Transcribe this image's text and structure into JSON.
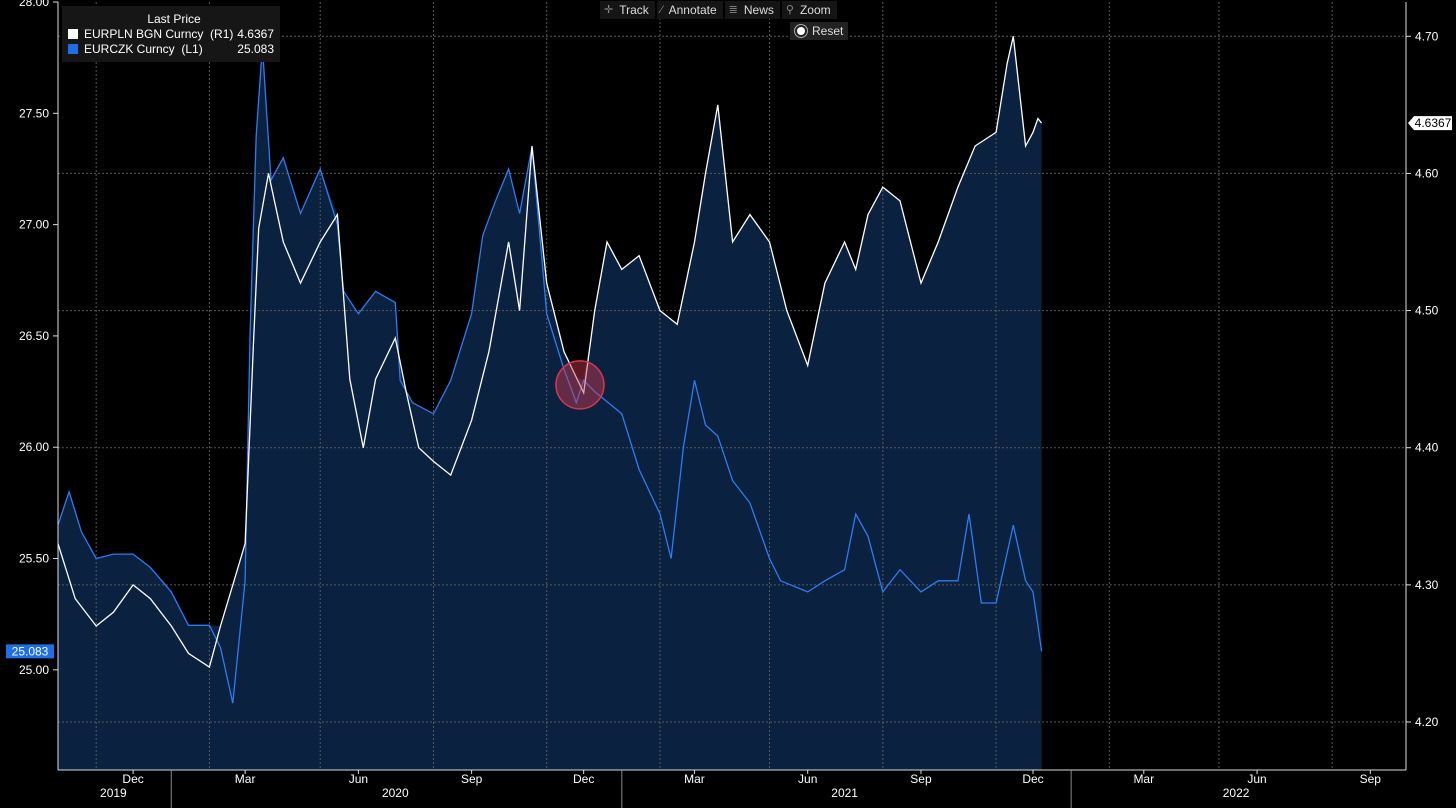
{
  "toolbar": {
    "track": "Track",
    "annotate": "Annotate",
    "news": "News",
    "zoom": "Zoom",
    "reset": "Reset"
  },
  "legend": {
    "header": "Last Price",
    "items": [
      {
        "name": "EURPLN BGN Curncy  (R1)",
        "value": "4.6367",
        "color": "#ffffff"
      },
      {
        "name": "EURCZK Curncy  (L1)",
        "value": "25.083",
        "color": "#1e6fe6"
      }
    ]
  },
  "colors": {
    "background": "#000000",
    "area_fill": "#0a2240",
    "czk_line": "#2e7bf0",
    "pln_line": "#ffffff",
    "highlight": "#d3384f"
  },
  "chart_data": {
    "type": "line",
    "x_ticks": [
      "Dec",
      "Mar",
      "Jun",
      "Sep",
      "Dec",
      "Mar",
      "Jun",
      "Sep",
      "Dec",
      "Mar",
      "Jun",
      "Sep"
    ],
    "years": [
      "2019",
      "2020",
      "2021",
      "2022"
    ],
    "xlim": [
      "2019-10-01",
      "2022-09-30"
    ],
    "y_left": {
      "ticks": [
        "25.00",
        "25.50",
        "26.00",
        "26.50",
        "27.00",
        "27.50",
        "28.00"
      ],
      "lim": [
        24.55,
        28.0
      ]
    },
    "y_right": {
      "ticks": [
        "4.20",
        "4.30",
        "4.40",
        "4.50",
        "4.60",
        "4.70"
      ],
      "lim": [
        4.165,
        4.725
      ]
    },
    "last_value_labels": {
      "left": "25.083",
      "right": "4.6367"
    },
    "grid": true,
    "series": [
      {
        "name": "EURCZK Curncy  (L1)",
        "axis": "left",
        "points": [
          [
            "2019-10-01",
            25.65
          ],
          [
            "2019-10-10",
            25.8
          ],
          [
            "2019-10-20",
            25.62
          ],
          [
            "2019-11-01",
            25.5
          ],
          [
            "2019-11-15",
            25.52
          ],
          [
            "2019-12-01",
            25.52
          ],
          [
            "2019-12-15",
            25.46
          ],
          [
            "2020-01-01",
            25.35
          ],
          [
            "2020-01-15",
            25.2
          ],
          [
            "2020-02-01",
            25.2
          ],
          [
            "2020-02-10",
            25.1
          ],
          [
            "2020-02-20",
            24.85
          ],
          [
            "2020-03-01",
            25.4
          ],
          [
            "2020-03-05",
            26.5
          ],
          [
            "2020-03-10",
            27.4
          ],
          [
            "2020-03-15",
            27.8
          ],
          [
            "2020-03-22",
            27.2
          ],
          [
            "2020-04-01",
            27.3
          ],
          [
            "2020-04-15",
            27.05
          ],
          [
            "2020-05-01",
            27.25
          ],
          [
            "2020-05-15",
            27.0
          ],
          [
            "2020-05-20",
            26.7
          ],
          [
            "2020-06-01",
            26.6
          ],
          [
            "2020-06-15",
            26.7
          ],
          [
            "2020-07-01",
            26.65
          ],
          [
            "2020-07-05",
            26.3
          ],
          [
            "2020-07-15",
            26.2
          ],
          [
            "2020-08-01",
            26.15
          ],
          [
            "2020-08-15",
            26.3
          ],
          [
            "2020-09-01",
            26.6
          ],
          [
            "2020-09-10",
            26.95
          ],
          [
            "2020-09-20",
            27.1
          ],
          [
            "2020-10-01",
            27.25
          ],
          [
            "2020-10-10",
            27.05
          ],
          [
            "2020-10-20",
            27.35
          ],
          [
            "2020-11-01",
            26.6
          ],
          [
            "2020-11-15",
            26.35
          ],
          [
            "2020-11-25",
            26.2
          ],
          [
            "2020-12-01",
            26.3
          ],
          [
            "2020-12-10",
            26.25
          ],
          [
            "2021-01-01",
            26.15
          ],
          [
            "2021-01-15",
            25.9
          ],
          [
            "2021-02-01",
            25.7
          ],
          [
            "2021-02-10",
            25.5
          ],
          [
            "2021-02-20",
            26.0
          ],
          [
            "2021-03-01",
            26.3
          ],
          [
            "2021-03-10",
            26.1
          ],
          [
            "2021-03-20",
            26.05
          ],
          [
            "2021-04-01",
            25.85
          ],
          [
            "2021-04-15",
            25.75
          ],
          [
            "2021-05-01",
            25.5
          ],
          [
            "2021-05-10",
            25.4
          ],
          [
            "2021-06-01",
            25.35
          ],
          [
            "2021-06-15",
            25.4
          ],
          [
            "2021-07-01",
            25.45
          ],
          [
            "2021-07-10",
            25.7
          ],
          [
            "2021-07-20",
            25.6
          ],
          [
            "2021-08-01",
            25.35
          ],
          [
            "2021-08-15",
            25.45
          ],
          [
            "2021-09-01",
            25.35
          ],
          [
            "2021-09-15",
            25.4
          ],
          [
            "2021-10-01",
            25.4
          ],
          [
            "2021-10-10",
            25.7
          ],
          [
            "2021-10-20",
            25.3
          ],
          [
            "2021-11-01",
            25.3
          ],
          [
            "2021-11-15",
            25.65
          ],
          [
            "2021-11-25",
            25.4
          ],
          [
            "2021-12-01",
            25.35
          ],
          [
            "2021-12-05",
            25.2
          ],
          [
            "2021-12-08",
            25.083
          ]
        ]
      },
      {
        "name": "EURPLN BGN Curncy  (R1)",
        "axis": "right",
        "points": [
          [
            "2019-10-01",
            4.33
          ],
          [
            "2019-10-15",
            4.29
          ],
          [
            "2019-11-01",
            4.27
          ],
          [
            "2019-11-15",
            4.28
          ],
          [
            "2019-12-01",
            4.3
          ],
          [
            "2019-12-15",
            4.29
          ],
          [
            "2020-01-01",
            4.27
          ],
          [
            "2020-01-15",
            4.25
          ],
          [
            "2020-02-01",
            4.24
          ],
          [
            "2020-02-10",
            4.27
          ],
          [
            "2020-02-20",
            4.3
          ],
          [
            "2020-03-01",
            4.33
          ],
          [
            "2020-03-08",
            4.48
          ],
          [
            "2020-03-12",
            4.56
          ],
          [
            "2020-03-20",
            4.6
          ],
          [
            "2020-04-01",
            4.55
          ],
          [
            "2020-04-15",
            4.52
          ],
          [
            "2020-05-01",
            4.55
          ],
          [
            "2020-05-15",
            4.57
          ],
          [
            "2020-05-25",
            4.45
          ],
          [
            "2020-06-05",
            4.4
          ],
          [
            "2020-06-15",
            4.45
          ],
          [
            "2020-07-01",
            4.48
          ],
          [
            "2020-07-10",
            4.44
          ],
          [
            "2020-07-20",
            4.4
          ],
          [
            "2020-08-01",
            4.39
          ],
          [
            "2020-08-15",
            4.38
          ],
          [
            "2020-09-01",
            4.42
          ],
          [
            "2020-09-15",
            4.47
          ],
          [
            "2020-10-01",
            4.55
          ],
          [
            "2020-10-10",
            4.5
          ],
          [
            "2020-10-20",
            4.62
          ],
          [
            "2020-11-01",
            4.52
          ],
          [
            "2020-11-15",
            4.47
          ],
          [
            "2020-12-01",
            4.44
          ],
          [
            "2020-12-10",
            4.5
          ],
          [
            "2020-12-20",
            4.55
          ],
          [
            "2021-01-01",
            4.53
          ],
          [
            "2021-01-15",
            4.54
          ],
          [
            "2021-02-01",
            4.5
          ],
          [
            "2021-02-15",
            4.49
          ],
          [
            "2021-03-01",
            4.55
          ],
          [
            "2021-03-10",
            4.6
          ],
          [
            "2021-03-20",
            4.65
          ],
          [
            "2021-04-01",
            4.55
          ],
          [
            "2021-04-15",
            4.57
          ],
          [
            "2021-05-01",
            4.55
          ],
          [
            "2021-05-15",
            4.5
          ],
          [
            "2021-06-01",
            4.46
          ],
          [
            "2021-06-15",
            4.52
          ],
          [
            "2021-07-01",
            4.55
          ],
          [
            "2021-07-10",
            4.53
          ],
          [
            "2021-07-20",
            4.57
          ],
          [
            "2021-08-01",
            4.59
          ],
          [
            "2021-08-15",
            4.58
          ],
          [
            "2021-09-01",
            4.52
          ],
          [
            "2021-09-15",
            4.55
          ],
          [
            "2021-10-01",
            4.59
          ],
          [
            "2021-10-15",
            4.62
          ],
          [
            "2021-11-01",
            4.63
          ],
          [
            "2021-11-10",
            4.68
          ],
          [
            "2021-11-15",
            4.7
          ],
          [
            "2021-11-25",
            4.62
          ],
          [
            "2021-12-01",
            4.63
          ],
          [
            "2021-12-05",
            4.64
          ],
          [
            "2021-12-08",
            4.6367
          ]
        ]
      }
    ]
  }
}
